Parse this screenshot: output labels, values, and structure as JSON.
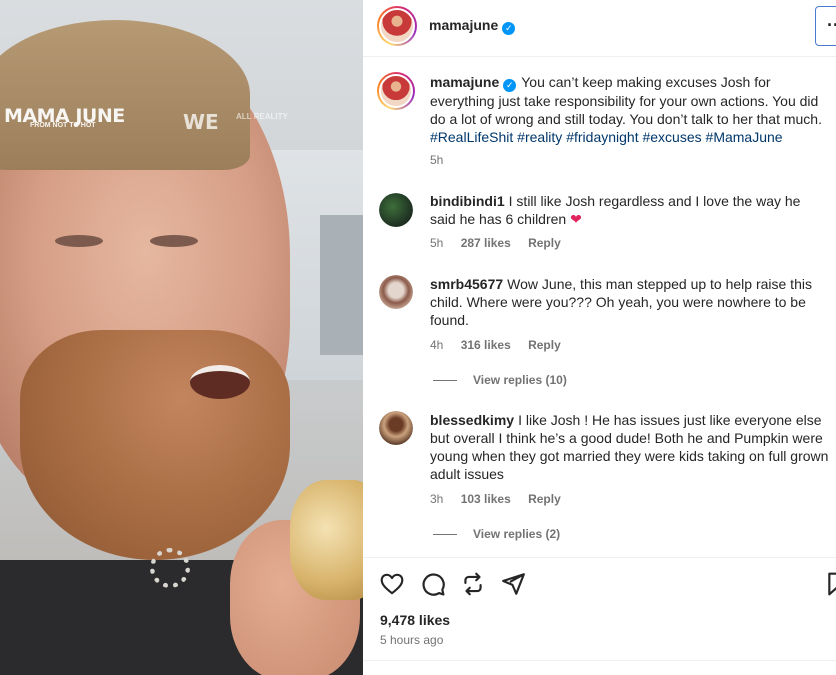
{
  "media": {
    "brand_title": "MAMA JUNE",
    "brand_sub": "FROM NOT TO HOT",
    "network": "WE",
    "network_sub": "ALL REALITY"
  },
  "post": {
    "author": "mamajune",
    "more_label": "···",
    "caption": "You can’t keep making excuses Josh for everything just take responsibility for your own actions. You did do a lot of wrong and still today. You don’t talk to her that much.",
    "hashtags": [
      "#RealLifeShit",
      "#reality",
      "#fridaynight",
      "#excuses",
      "#MamaJune"
    ],
    "caption_time": "5h",
    "likes": "9,478 likes",
    "posted_ago": "5 hours ago"
  },
  "comments": [
    {
      "user": "bindibindi1",
      "text": "I still like Josh regardless and I love the way he said he has 6 children",
      "emoji": "❤",
      "time": "5h",
      "likes": "287 likes",
      "reply": "Reply"
    },
    {
      "user": "smrb45677",
      "text": "Wow June, this man stepped up to help raise this child. Where were you??? Oh yeah, you were nowhere to be found.",
      "time": "4h",
      "likes": "316 likes",
      "reply": "Reply",
      "view_replies": "View replies (10)"
    },
    {
      "user": "blessedkimy",
      "text": "I like Josh ! He has issues just like everyone else but overall I think he’s a good dude! Both he and Pumpkin were young when they got married they were kids taking on full grown adult issues",
      "time": "3h",
      "likes": "103 likes",
      "reply": "Reply",
      "view_replies": "View replies (2)"
    }
  ],
  "icons": {
    "verified": "verified-badge-icon",
    "like": "heart-icon",
    "comment": "comment-icon",
    "share": "repost-icon",
    "send": "send-icon",
    "save": "bookmark-icon"
  },
  "colors": {
    "accent": "#0095f6",
    "link": "#00376b",
    "muted": "#737373"
  }
}
